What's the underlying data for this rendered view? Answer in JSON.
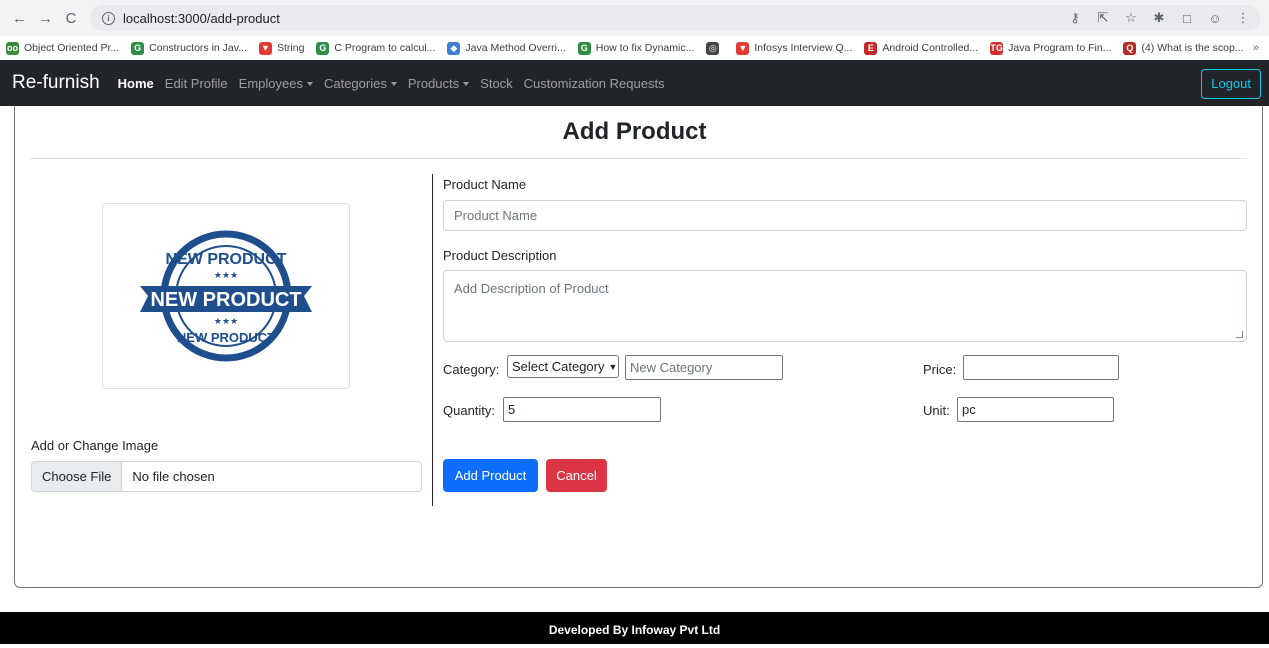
{
  "browser": {
    "url": "localhost:3000/add-product",
    "bookmarks": [
      {
        "label": "Object Oriented Pr...",
        "icon": "oo",
        "color": "#3c8a3c"
      },
      {
        "label": "Constructors in Jav...",
        "icon": "G",
        "color": "#2f8d46"
      },
      {
        "label": "String",
        "icon": "▼",
        "color": "#e53935"
      },
      {
        "label": "C Program to calcul...",
        "icon": "G",
        "color": "#2f8d46"
      },
      {
        "label": "Java Method Overri...",
        "icon": "◆",
        "color": "#3f7fd8"
      },
      {
        "label": "How to fix Dynamic...",
        "icon": "G",
        "color": "#2f8d46"
      },
      {
        "label": "",
        "icon": "◎",
        "color": "#444444"
      },
      {
        "label": "Infosys Interview Q...",
        "icon": "▼",
        "color": "#e53935"
      },
      {
        "label": "Android Controlled...",
        "icon": "E",
        "color": "#c62828"
      },
      {
        "label": "Java Program to Fin...",
        "icon": "TG",
        "color": "#d32f2f"
      },
      {
        "label": "(4) What is the scop...",
        "icon": "Q",
        "color": "#b92b27"
      }
    ],
    "more": "»"
  },
  "navbar": {
    "brand": "Re-furnish",
    "links": {
      "home": "Home",
      "edit_profile": "Edit Profile",
      "employees": "Employees",
      "categories": "Categories",
      "products": "Products",
      "stock": "Stock",
      "customization": "Customization Requests"
    },
    "logout": "Logout"
  },
  "form": {
    "title": "Add Product",
    "image_stamp_top": "NEW PRODUCT",
    "image_stamp_center": "NEW PRODUCT",
    "image_label": "Add or Change Image",
    "file_button": "Choose File",
    "file_status": "No file chosen",
    "product_name_label": "Product Name",
    "product_name_placeholder": "Product Name",
    "description_label": "Product Description",
    "description_placeholder": "Add Description of Product",
    "category_label": "Category:",
    "category_select": "Select Category",
    "new_category_placeholder": "New Category",
    "price_label": "Price:",
    "price_value": "",
    "quantity_label": "Quantity:",
    "quantity_value": "5",
    "unit_label": "Unit:",
    "unit_value": "pc",
    "add_button": "Add Product",
    "cancel_button": "Cancel"
  },
  "footer": {
    "text": "Developed By Infoway Pvt Ltd"
  },
  "colors": {
    "navbar_bg": "#212529",
    "primary": "#0d6efd",
    "danger": "#dc3545",
    "logout_outline": "#0dcaf0",
    "stamp_blue": "#1f4e8c"
  }
}
